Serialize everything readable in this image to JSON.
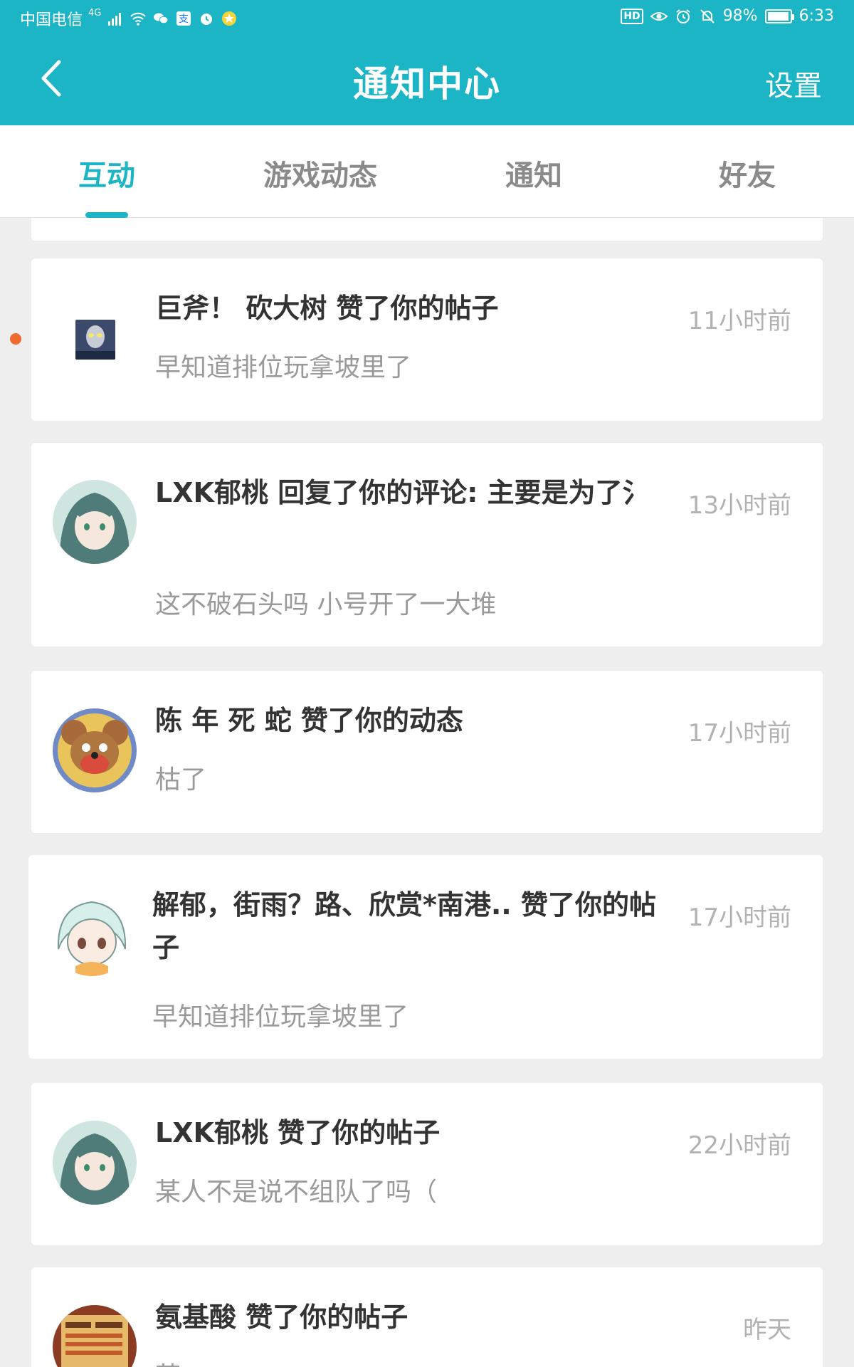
{
  "status_bar": {
    "carrier": "中国电信",
    "network": "4G",
    "battery_percent": "98%",
    "battery_level": 0.98,
    "time": "6:33",
    "hd_label": "HD",
    "left_icons": [
      "signal-icon",
      "wifi-icon",
      "wechat-icon",
      "alipay-icon",
      "alarm-app-icon",
      "star-icon"
    ],
    "right_icons": [
      "hd-icon",
      "eye-icon",
      "alarm-icon",
      "mute-icon",
      "battery-icon"
    ]
  },
  "header": {
    "title": "通知中心",
    "back_icon": "chevron-left-icon",
    "settings_label": "设置"
  },
  "tabs": [
    {
      "label": "互动",
      "active": true
    },
    {
      "label": "游戏动态",
      "active": false
    },
    {
      "label": "通知",
      "active": false
    },
    {
      "label": "好友",
      "active": false
    }
  ],
  "notifications": [
    {
      "title": "巨斧！ 砍大树 赞了你的帖子",
      "subtitle": "早知道排位玩拿坡里了",
      "time": "11小时前",
      "unread": true,
      "avatar": "ultraman-avatar"
    },
    {
      "title": "LXK郁桃 回复了你的评论: 主要是为了氵",
      "subtitle": "这不破石头吗  小号开了一大堆",
      "time": "13小时前",
      "unread": false,
      "avatar": "anime-girl-avatar"
    },
    {
      "title": "陈 年 死 蛇 赞了你的动态",
      "subtitle": "枯了",
      "time": "17小时前",
      "unread": false,
      "avatar": "cartoon-mouse-avatar"
    },
    {
      "title": "解郁，街雨？路、欣赏*南港.. 赞了你的帖子",
      "subtitle": "早知道排位玩拿坡里了",
      "time": "17小时前",
      "unread": false,
      "avatar": "chibi-avatar"
    },
    {
      "title": "LXK郁桃 赞了你的帖子",
      "subtitle": "某人不是说不组队了吗（",
      "time": "22小时前",
      "unread": false,
      "avatar": "anime-girl-avatar"
    },
    {
      "title": "氨基酸 赞了你的帖子",
      "subtitle": "萌",
      "time": "昨天",
      "unread": false,
      "avatar": "game-screenshot-avatar"
    }
  ],
  "colors": {
    "accent": "#1bb5c6",
    "unread_dot": "#f06a2f",
    "title_text": "#333333",
    "sub_text": "#9a9a9a",
    "time_text": "#b2b2b2"
  }
}
